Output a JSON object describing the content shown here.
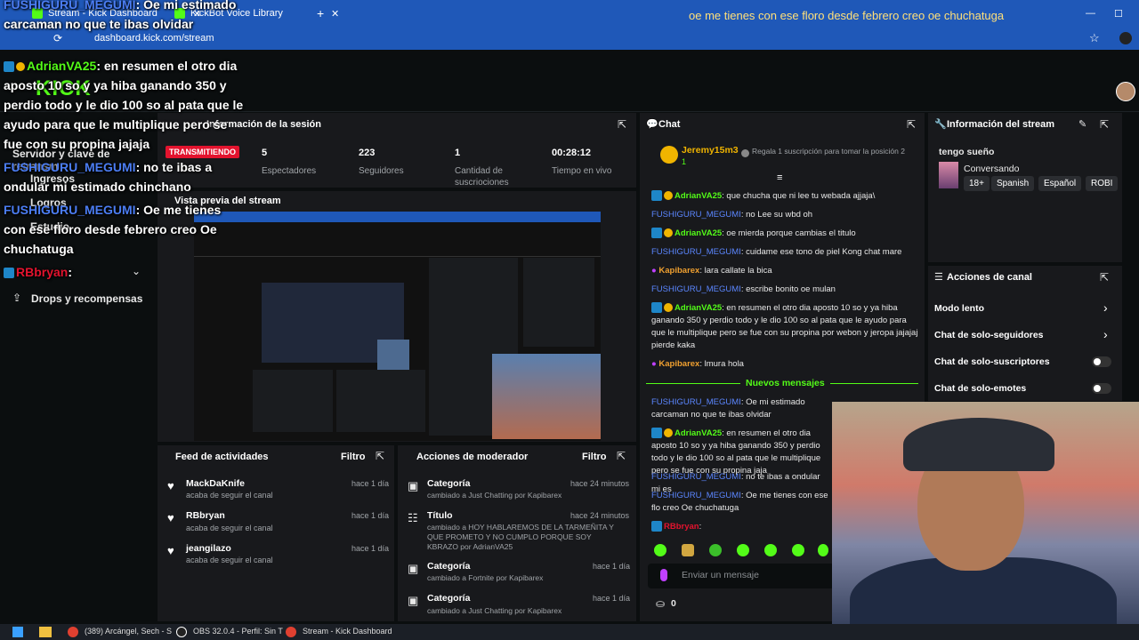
{
  "browser": {
    "tabs": [
      {
        "label": "Stream - Kick Dashboard"
      },
      {
        "label": "KickBot Voice Library"
      }
    ],
    "window_title": "oe me tienes con ese floro desde febrero creo oe chuchatuga",
    "url": "dashboard.kick.com/stream"
  },
  "site": {
    "logo": "KICK"
  },
  "nav": {
    "items": [
      {
        "label": "Servidor y clave de retransm"
      },
      {
        "label": "Ingresos"
      },
      {
        "label": "Logros"
      },
      {
        "label": "Estudio"
      },
      {
        "label": "Drops y recompensas"
      }
    ]
  },
  "session": {
    "title": "Información de la sesión",
    "live_badge": "TRANSMITIENDO",
    "stats": [
      {
        "value": "5",
        "label": "Espectadores"
      },
      {
        "value": "223",
        "label": "Seguidores"
      },
      {
        "value": "1",
        "label": "Cantidad de suscriociones"
      },
      {
        "value": "00:28:12",
        "label": "Tiempo en vivo"
      }
    ]
  },
  "preview": {
    "title": "Vista previa del stream"
  },
  "chat": {
    "title": "Chat",
    "pinned_user": "Jeremy15m3",
    "pinned_count": "1",
    "gift_text": "Regala 1 suscripción para tomar la posición",
    "gift_pos": "2",
    "messages": [
      {
        "user": "AdrianVA25",
        "text": ": que chucha que ni lee tu webada ajjaja\\"
      },
      {
        "user": "FUSHIGURU_MEGUMI",
        "text": ": no Lee su wbd oh"
      },
      {
        "user": "AdrianVA25",
        "text": ": oe mierda porque cambias el titulo"
      },
      {
        "user": "FUSHIGURU_MEGUMI",
        "text": ": cuidame ese tono de piel Kong chat mare"
      },
      {
        "user": "Kapibarex",
        "text": ": lara callate la bica"
      },
      {
        "user": "FUSHIGURU_MEGUMI",
        "text": ": escribe bonito oe mulan"
      },
      {
        "user": "AdrianVA25",
        "text": ": en resumen el otro dia aposto 10 so y ya hiba ganando 350 y perdio todo y le dio 100 so al pata que le ayudo para que le multiplique pero se fue con su propina por webon y jeropa jajajaj pierde kaka"
      },
      {
        "user": "Kapibarex",
        "text": ": lmura hola"
      }
    ],
    "new_messages": "Nuevos mensajes",
    "new_msgs": [
      {
        "user": "FUSHIGURU_MEGUMI",
        "text": ": Oe mi estimado carcaman no que te ibas olvidar"
      },
      {
        "user": "AdrianVA25",
        "text": ": en resumen el otro dia aposto 10 so y ya hiba ganando 350 y perdio todo y le dio 100 so al pata que le multiplique pero se fue con su propina jaja"
      },
      {
        "user": "FUSHIGURU_MEGUMI",
        "text": ": no te ibas a ondular mi es"
      },
      {
        "user": "FUSHIGURU_MEGUMI",
        "text": ": Oe me tienes con ese flo creo Oe chuchatuga"
      },
      {
        "user": "RBbryan",
        "text": ":"
      }
    ],
    "input_placeholder": "Enviar un mensaje",
    "points": "0"
  },
  "stream_info": {
    "title": "Información del stream",
    "stream_title": "tengo sueño",
    "category": "Conversando",
    "tags": [
      "18+",
      "Spanish",
      "Español",
      "ROBI"
    ]
  },
  "actions": {
    "title": "Acciones de canal",
    "items": [
      {
        "label": "Modo lento"
      },
      {
        "label": "Chat de solo-seguidores"
      },
      {
        "label": "Chat de solo-suscriptores"
      },
      {
        "label": "Chat de solo-emotes"
      }
    ]
  },
  "feed": {
    "title": "Feed de actividades",
    "filter": "Filtro",
    "items": [
      {
        "name": "MackDaKnife",
        "sub": "acaba de seguir el canal",
        "time": "hace 1 día"
      },
      {
        "name": "RBbryan",
        "sub": "acaba de seguir el canal",
        "time": "hace 1 día"
      },
      {
        "name": "jeangilazo",
        "sub": "acaba de seguir el canal",
        "time": "hace 1 día"
      }
    ]
  },
  "moderator": {
    "title": "Acciones de moderador",
    "filter": "Filtro",
    "items": [
      {
        "title": "Categoría",
        "sub": "cambiado a Just Chatting por Kapibarex",
        "time": "hace 24 minutos"
      },
      {
        "title": "Título",
        "sub": "cambiado a HOY HABLAREMOS DE LA TARMEÑITA Y QUE PROMETO Y NO CUMPLO PORQUE SOY KBRAZO por AdrianVA25",
        "time": "hace 24 minutos"
      },
      {
        "title": "Categoría",
        "sub": "cambiado a Fortnite por Kapibarex",
        "time": "hace 1 día"
      },
      {
        "title": "Categoría",
        "sub": "cambiado a Just Chatting por Kapibarex",
        "time": "hace 1 día"
      }
    ]
  },
  "overlay": {
    "lines": [
      {
        "user": "FUSHIGURU_MEGUMI",
        "text": ": Oe mi estimado carcaman no que te ibas olvidar"
      },
      {
        "user": "AdrianVA25",
        "text": ": en resumen el otro dia aposto 10 so y ya hiba ganando 350 y perdio todo y le dio 100 so al pata que le ayudo para que le multiplique pero se fue con su propina jajaja"
      },
      {
        "user": "FUSHIGURU_MEGUMI",
        "text": ": no te ibas a ondular mi estimado chinchano"
      },
      {
        "user": "FUSHIGURU_MEGUMI",
        "text": ": Oe me tienes con ese floro desde febrero creo Oe chuchatuga"
      },
      {
        "user": "RBbryan",
        "text": ":"
      }
    ]
  },
  "taskbar": {
    "items": [
      {
        "label": "(389) Arcángel, Sech - S"
      },
      {
        "label": "OBS 32.0.4 - Perfil: Sin T"
      },
      {
        "label": "Stream - Kick Dashboard"
      }
    ]
  },
  "colors": {
    "kick_green": "#53fc18",
    "chrome_blue": "#1f58b8",
    "live_red": "#e3132e",
    "panel": "#18191c"
  }
}
